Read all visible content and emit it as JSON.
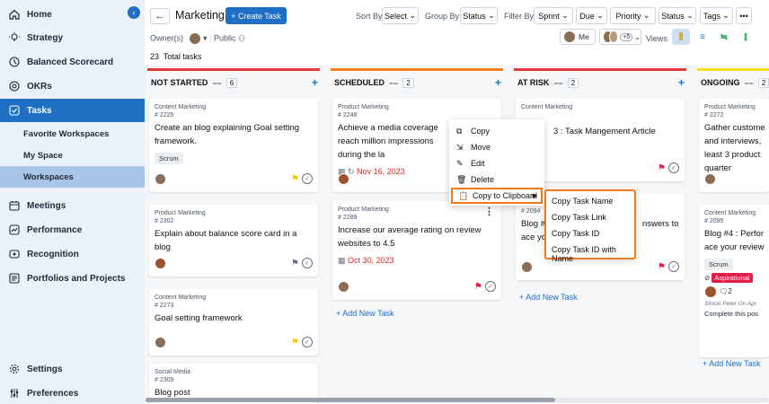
{
  "sidebar": {
    "items": [
      {
        "label": "Home",
        "icon": "home-icon"
      },
      {
        "label": "Strategy",
        "icon": "bulb-icon"
      },
      {
        "label": "Balanced Scorecard",
        "icon": "scorecard-icon"
      },
      {
        "label": "OKRs",
        "icon": "target-icon"
      },
      {
        "label": "Tasks",
        "icon": "checkbox-icon"
      },
      {
        "label": "Meetings",
        "icon": "calendar-icon"
      },
      {
        "label": "Performance",
        "icon": "performance-icon"
      },
      {
        "label": "Recognition",
        "icon": "recognition-icon"
      },
      {
        "label": "Portfolios and Projects",
        "icon": "portfolio-icon"
      },
      {
        "label": "Settings",
        "icon": "gear-icon"
      },
      {
        "label": "Preferences",
        "icon": "sliders-icon"
      }
    ],
    "subitems": [
      {
        "label": "Favorite Workspaces"
      },
      {
        "label": "My Space"
      },
      {
        "label": "Workspaces"
      }
    ]
  },
  "header": {
    "workspace": "Marketing",
    "create_label": "+ Create Task",
    "sort_by_label": "Sort By",
    "sort_by_value": "Select",
    "group_by_label": "Group By",
    "group_by_value": "Status",
    "filter_by_label": "Filter By",
    "filters": [
      "Sprint",
      "Due",
      "Priority",
      "Status",
      "Tags"
    ],
    "owners_label": "Owner(s)",
    "visibility": "Public",
    "me_label": "Me",
    "team_count": "+5",
    "views_label": "Views"
  },
  "board": {
    "total": "23",
    "total_label": "Total tasks",
    "add_task_label": "+ Add New Task",
    "columns": [
      {
        "name": "NOT STARTED",
        "count": "6",
        "color": "#e53935"
      },
      {
        "name": "SCHEDULED",
        "count": "2",
        "color": "#f57c1f"
      },
      {
        "name": "AT RISK",
        "count": "2",
        "color": "#e53935"
      },
      {
        "name": "ONGOING",
        "count": "2",
        "color": "#f5e11a"
      }
    ],
    "cards": {
      "ns1": {
        "cat": "Content Marketing",
        "num": "# 2225",
        "title": "Create an blog explaining Goal setting framework.",
        "tag": "Scrum"
      },
      "ns2": {
        "cat": "Product Marketing",
        "num": "# 2302",
        "title": "Explain about balance score card in a blog"
      },
      "ns3": {
        "cat": "Content Marketing",
        "num": "# 2273",
        "title": "Goal setting framework"
      },
      "ns4": {
        "cat": "Social Media",
        "num": "# 2309",
        "title": "Blog post"
      },
      "sc1": {
        "cat": "Product Marketing",
        "num": "# 2248",
        "title": "Achieve a media coverage reach million impressions during the la",
        "date": "Nov 16, 2023"
      },
      "sc2": {
        "cat": "Product Marketing",
        "num": "# 2289",
        "title": "Increase our average rating on review websites to 4.5",
        "date": "Oct 30, 2023"
      },
      "ar1": {
        "cat": "Content Marketing",
        "title": "3 : Task Mangement Article"
      },
      "ar2": {
        "num": "# 2094",
        "title_a": "Blog #",
        "title_b": "nswers to",
        "title_c": "ace yo"
      },
      "on1": {
        "cat": "Product Marketing",
        "num": "# 2272",
        "title": "Gather custome and interviews, least 3 product quarter"
      },
      "on2": {
        "cat": "Content Marketing",
        "num": "# 2095",
        "title": "Blog #4 : Perfor ace your review",
        "tag": "Scrum",
        "tag2": "Aspirational",
        "comments": "2",
        "comment_meta": "Simon Peter On Apr",
        "comment_text": "Complete this pos"
      }
    }
  },
  "context_menu": {
    "items": [
      "Copy",
      "Move",
      "Edit",
      "Delete",
      "Copy to Clipboard"
    ],
    "submenu": [
      "Copy Task Name",
      "Copy Task Link",
      "Copy Task ID",
      "Copy Task ID with Name"
    ]
  },
  "colors": {
    "accent": "#1f6fc5",
    "highlight": "#f07a1a",
    "flag_yellow": "#f5c518",
    "flag_red": "#e11d48"
  }
}
